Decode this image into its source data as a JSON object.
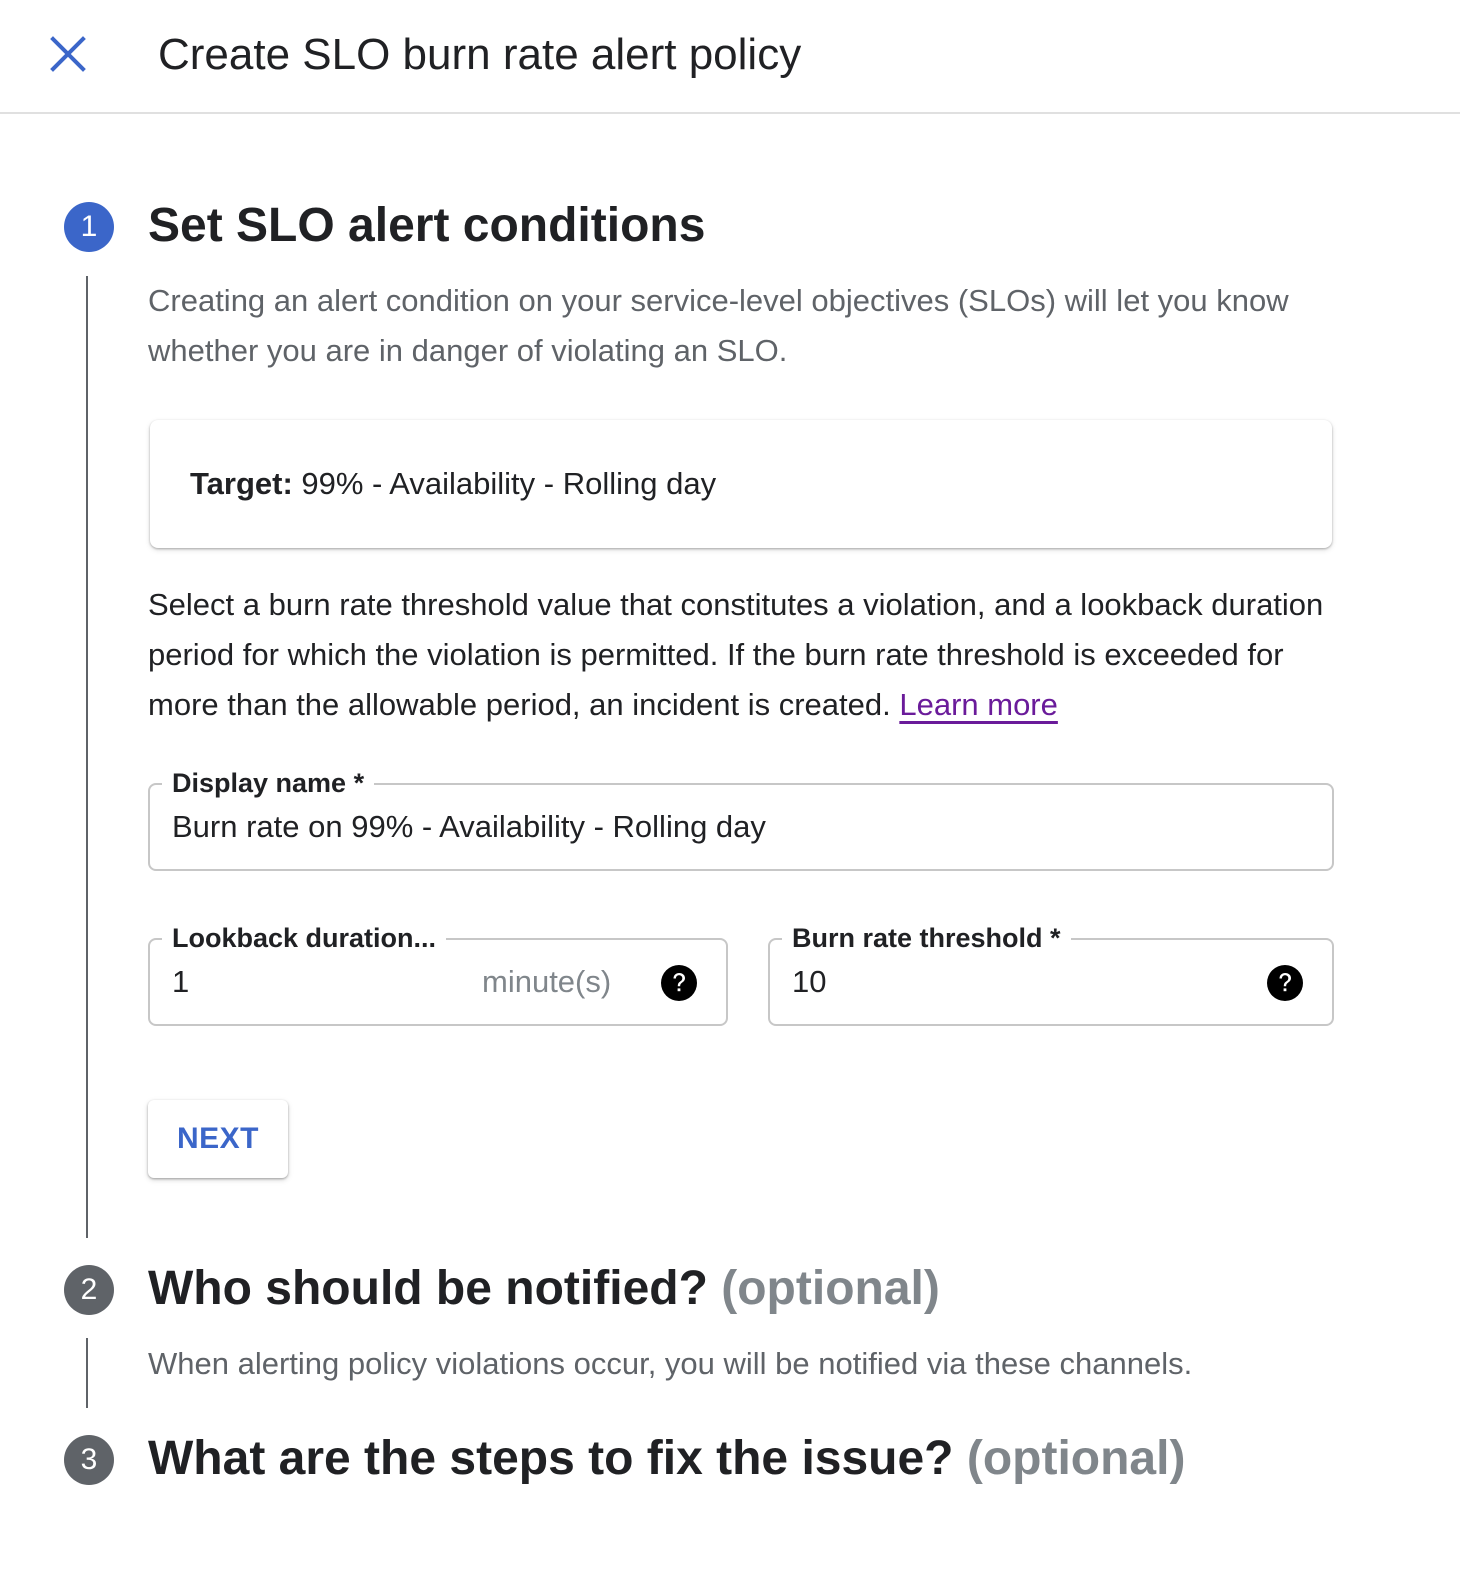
{
  "header": {
    "title": "Create SLO burn rate alert policy",
    "close_icon": "close-icon"
  },
  "colors": {
    "accent": "#3b66c9",
    "step_inactive": "#5f6368",
    "link": "#6a1b9a"
  },
  "steps": [
    {
      "number": "1",
      "title": "Set SLO alert conditions",
      "optional": "",
      "description": "Creating an alert condition on your service-level objectives (SLOs) will let you know whether you are in danger of violating an SLO."
    },
    {
      "number": "2",
      "title": "Who should be notified?",
      "optional": "(optional)",
      "description": "When alerting policy violations occur, you will be notified via these channels."
    },
    {
      "number": "3",
      "title": "What are the steps to fix the issue?",
      "optional": "(optional)",
      "description": ""
    }
  ],
  "target": {
    "label": "Target:",
    "value": " 99% - Availability - Rolling day"
  },
  "instructions": {
    "text": "Select a burn rate threshold value that constitutes a violation, and a lookback duration period for which the violation is permitted. If the burn rate threshold is exceeded for more than the allowable period, an incident is created. ",
    "link": "Learn more"
  },
  "fields": {
    "display_name": {
      "label": "Display name *",
      "value": "Burn rate on 99% - Availability - Rolling day"
    },
    "lookback": {
      "label": "Lookback duration...",
      "value": "1",
      "suffix": "minute(s)",
      "help_icon": "help-icon"
    },
    "burn_rate": {
      "label": "Burn rate threshold *",
      "value": "10",
      "help_icon": "help-icon"
    }
  },
  "buttons": {
    "next": "NEXT"
  }
}
